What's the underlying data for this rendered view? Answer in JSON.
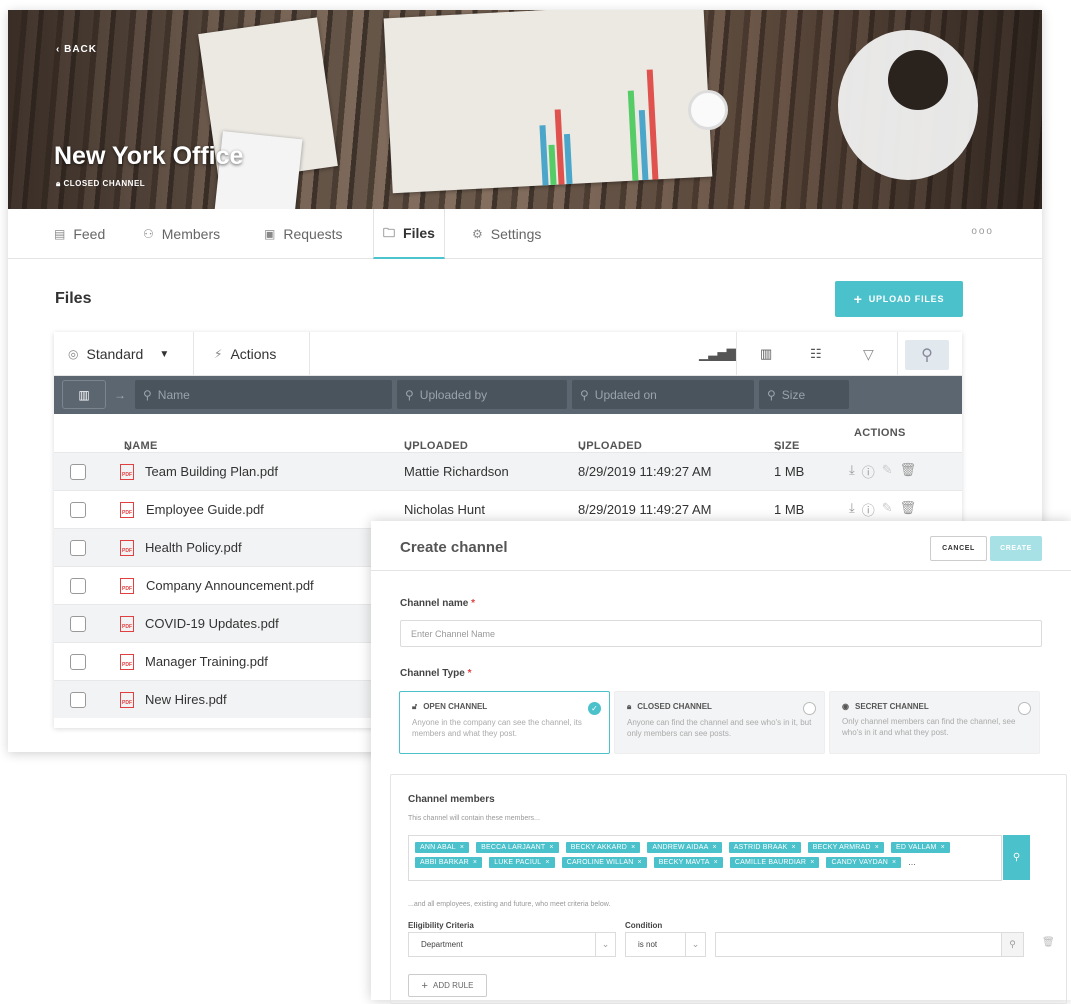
{
  "hero": {
    "back": "BACK",
    "title": "New York Office",
    "subtitle": "CLOSED CHANNEL"
  },
  "tabs": [
    {
      "label": "Feed",
      "icon": "feed-icon"
    },
    {
      "label": "Members",
      "icon": "members-icon"
    },
    {
      "label": "Requests",
      "icon": "requests-icon"
    },
    {
      "label": "Files",
      "icon": "folder-icon",
      "active": true
    },
    {
      "label": "Settings",
      "icon": "gear-icon"
    }
  ],
  "more": "ooo",
  "files": {
    "title": "Files",
    "upload_label": "UPLOAD FILES",
    "view_label": "Standard",
    "actions_label": "Actions",
    "filters": {
      "name": "Name",
      "uploaded_by": "Uploaded by",
      "updated_on": "Updated on",
      "size": "Size"
    },
    "columns": {
      "name": "NAME",
      "uploaded_by": "UPLOADED BY",
      "uploaded_on": "UPLOADED ON",
      "size": "SIZE",
      "actions": "ACTIONS"
    },
    "rows": [
      {
        "name": "Team Building Plan.pdf",
        "by": "Mattie Richardson",
        "on": "8/29/2019 11:49:27 AM",
        "size": "1 MB"
      },
      {
        "name": "Employee Guide.pdf",
        "by": "Nicholas Hunt",
        "on": "8/29/2019 11:49:27 AM",
        "size": "1 MB"
      },
      {
        "name": "Health Policy.pdf"
      },
      {
        "name": "Company Announcement.pdf"
      },
      {
        "name": "COVID-19 Updates.pdf"
      },
      {
        "name": "Manager Training.pdf"
      },
      {
        "name": "New Hires.pdf"
      }
    ],
    "pdf_badge": "PDF"
  },
  "dialog": {
    "title": "Create channel",
    "cancel": "CANCEL",
    "create": "CREATE",
    "name_label": "Channel name",
    "name_placeholder": "Enter Channel Name",
    "type_label": "Channel Type",
    "required": "*",
    "types": [
      {
        "title": "OPEN CHANNEL",
        "desc": "Anyone in the company can see the channel, its members and what they post."
      },
      {
        "title": "CLOSED CHANNEL",
        "desc": "Anyone can find the channel and see who's in it, but only members can see posts."
      },
      {
        "title": "SECRET CHANNEL",
        "desc": "Only channel members can find the channel, see who's in it and what they post."
      }
    ],
    "members_label": "Channel members",
    "members_hint": "This channel will contain these members...",
    "members": [
      "ANN ABAL",
      "BECCA LARJAANT",
      "BECKY AKKARD",
      "ANDREW AIDAA",
      "ASTRID BRAAK",
      "BECKY ARMRAD",
      "ED VALLAM",
      "ABBI BARKAR",
      "LUKE PACIUL",
      "CAROLINE WILLAN",
      "BECKY MAVTA",
      "CAMILLE BAURDIAR",
      "CANDY VAYDAN"
    ],
    "members_more": "...",
    "criteria_hint": "...and all employees, existing and future, who meet criteria below.",
    "eligibility_label": "Eligibility Criteria",
    "condition_label": "Condition",
    "eligibility_value": "Department",
    "condition_value": "is not",
    "add_rule": "ADD RULE"
  }
}
